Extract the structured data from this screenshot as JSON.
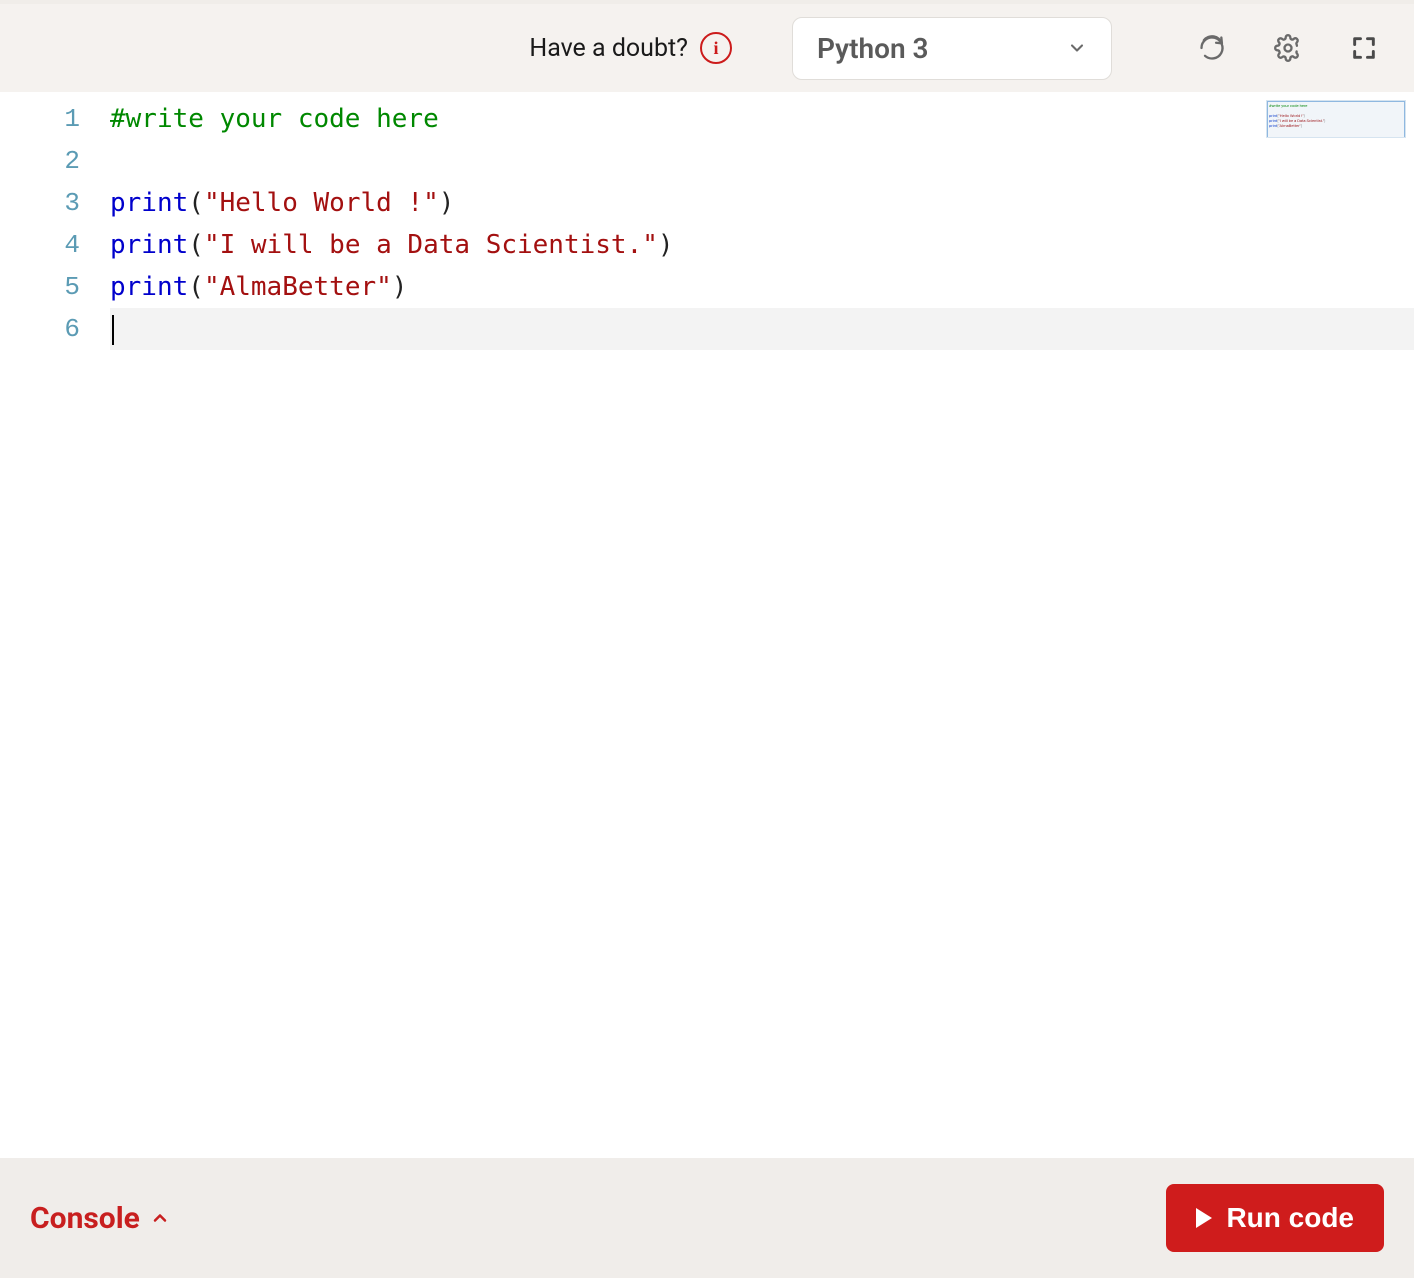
{
  "toolbar": {
    "doubt_text": "Have a doubt?",
    "language_label": "Python 3"
  },
  "editor": {
    "lines": [
      {
        "no": "1",
        "tokens": [
          {
            "cls": "tok-comment",
            "text": "#write your code here"
          }
        ]
      },
      {
        "no": "2",
        "tokens": []
      },
      {
        "no": "3",
        "tokens": [
          {
            "cls": "tok-func",
            "text": "print"
          },
          {
            "cls": "tok-paren",
            "text": "("
          },
          {
            "cls": "tok-string",
            "text": "\"Hello World !\""
          },
          {
            "cls": "tok-paren",
            "text": ")"
          }
        ]
      },
      {
        "no": "4",
        "tokens": [
          {
            "cls": "tok-func",
            "text": "print"
          },
          {
            "cls": "tok-paren",
            "text": "("
          },
          {
            "cls": "tok-string",
            "text": "\"I will be a Data Scientist.\""
          },
          {
            "cls": "tok-paren",
            "text": ")"
          }
        ]
      },
      {
        "no": "5",
        "tokens": [
          {
            "cls": "tok-func",
            "text": "print"
          },
          {
            "cls": "tok-paren",
            "text": "("
          },
          {
            "cls": "tok-string",
            "text": "\"AlmaBetter\""
          },
          {
            "cls": "tok-paren",
            "text": ")"
          }
        ]
      },
      {
        "no": "6",
        "tokens": [],
        "cursor": true
      }
    ]
  },
  "bottom": {
    "console_label": "Console",
    "run_label": "Run code"
  },
  "colors": {
    "accent_red": "#cf1c1c",
    "comment_green": "#008800",
    "func_blue": "#0000cc",
    "string_red": "#a31010",
    "lineno_teal": "#5b9bb4"
  }
}
